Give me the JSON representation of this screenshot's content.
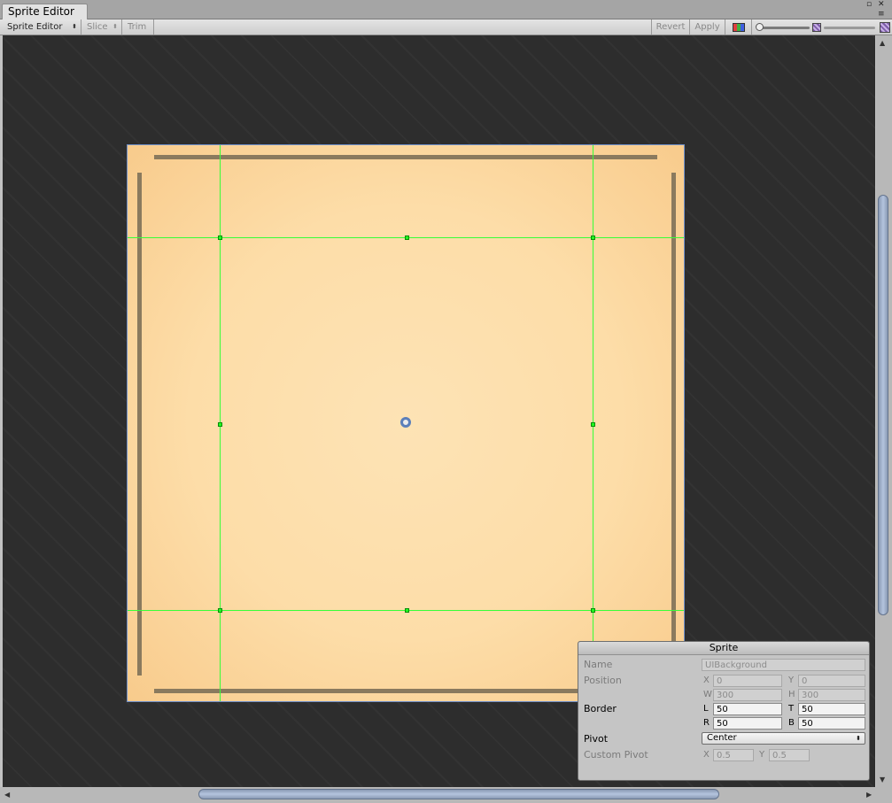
{
  "window": {
    "tab_title": "Sprite Editor",
    "controls": {
      "maximize_glyph": "▫",
      "close_glyph": "✕",
      "menu_glyph": "≡"
    }
  },
  "toolbar": {
    "mode_dropdown": "Sprite Editor",
    "slice_dropdown": "Slice",
    "trim_button": "Trim",
    "revert_button": "Revert",
    "apply_button": "Apply",
    "dropdown_arrows": "⬍"
  },
  "scrollbar_glyphs": {
    "up": "▲",
    "down": "▼",
    "left": "◀",
    "right": "▶"
  },
  "sprite_panel": {
    "title": "Sprite",
    "name_label": "Name",
    "name_value": "UIBackground",
    "position_label": "Position",
    "x_label": "X",
    "x_value": "0",
    "y_label": "Y",
    "y_value": "0",
    "w_label": "W",
    "w_value": "300",
    "h_label": "H",
    "h_value": "300",
    "border_label": "Border",
    "l_label": "L",
    "l_value": "50",
    "t_label": "T",
    "t_value": "50",
    "r_label": "R",
    "r_value": "50",
    "b_label": "B",
    "b_value": "50",
    "pivot_label": "Pivot",
    "pivot_value": "Center",
    "custom_pivot_label": "Custom Pivot",
    "custom_x_label": "X",
    "custom_x_value": "0.5",
    "custom_y_label": "Y",
    "custom_y_value": "0.5"
  },
  "colors": {
    "guide_line": "#37ff37",
    "sprite_fill": "#fddda8",
    "sprite_outline": "#6f8fc8",
    "pivot_ring": "#5b7fba",
    "canvas_background": "#2d2d2d"
  }
}
